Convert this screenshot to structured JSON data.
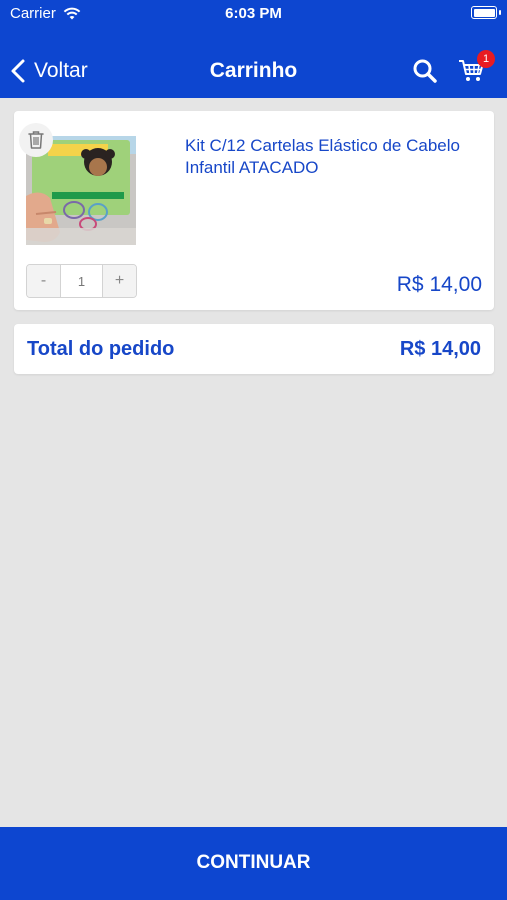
{
  "status_bar": {
    "carrier": "Carrier",
    "time": "6:03 PM"
  },
  "navbar": {
    "back_label": "Voltar",
    "title": "Carrinho",
    "cart_badge_count": "1"
  },
  "cart": {
    "items": [
      {
        "name": "Kit C/12 Cartelas Elástico de Cabelo Infantil ATACADO",
        "quantity": "1",
        "price": "R$ 14,00",
        "decrement_label": "-",
        "increment_label": "+"
      }
    ],
    "total_label": "Total do pedido",
    "total_value": "R$ 14,00"
  },
  "continue_label": "CONTINUAR",
  "colors": {
    "brand_blue": "#0d46d0",
    "text_blue": "#1747c8",
    "badge_red": "#e81b22",
    "background": "#e5e5e5"
  }
}
